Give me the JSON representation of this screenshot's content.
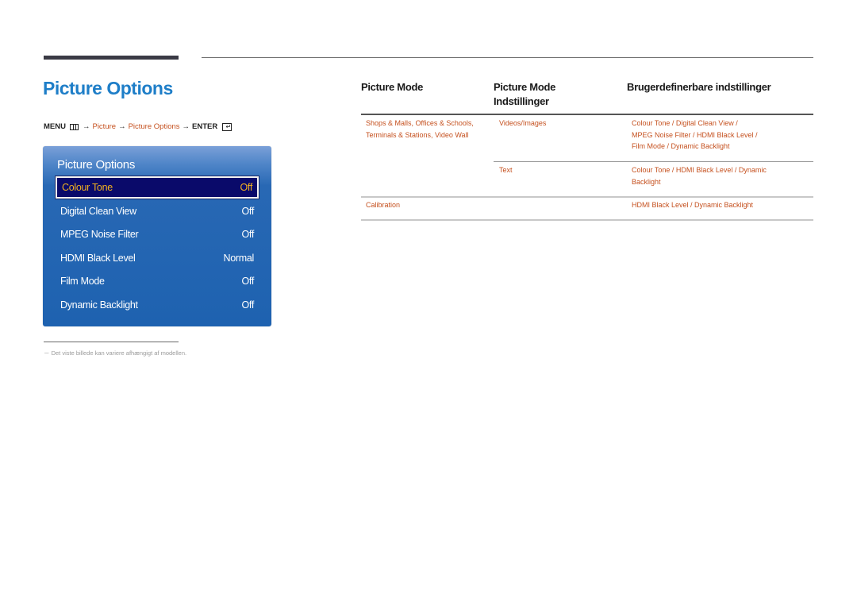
{
  "page": {
    "title": "Picture Options",
    "menu_path": {
      "menu_label": "MENU",
      "arrow": "→",
      "link_1": "Picture",
      "link_2": "Picture Options",
      "enter_label": "ENTER",
      "enter_glyph": "↵"
    },
    "footnote": "－ Det viste billede kan variere afhængigt af modellen."
  },
  "osd": {
    "title": "Picture Options",
    "items": [
      {
        "label": "Colour Tone",
        "value": "Off",
        "selected": true
      },
      {
        "label": "Digital Clean View",
        "value": "Off"
      },
      {
        "label": "MPEG Noise Filter",
        "value": "Off"
      },
      {
        "label": "HDMI Black Level",
        "value": "Normal"
      },
      {
        "label": "Film Mode",
        "value": "Off"
      },
      {
        "label": "Dynamic Backlight",
        "value": "Off"
      }
    ],
    "colors": {
      "selected_text": "#f0b020",
      "selected_bg": "#0a0a6a",
      "panel": "#1e62b0"
    }
  },
  "table": {
    "headers": [
      "Picture Mode",
      "Picture Mode Indstillinger",
      "Brugerdefinerbare indstillinger"
    ],
    "header_2_lines": [
      "Picture Mode",
      "Indstillinger"
    ],
    "rows": [
      {
        "mode_lines": [
          "Shops & Malls, Offices & Schools,",
          "Terminals & Stations, Video Wall"
        ],
        "setting": "Videos/Images",
        "custom_lines": [
          "Colour Tone / Digital Clean View /",
          "MPEG Noise Filter / HDMI Black Level /",
          "Film Mode / Dynamic Backlight"
        ]
      },
      {
        "mode_lines": [],
        "setting": "Text",
        "custom_lines": [
          "Colour Tone / HDMI Black Level / Dynamic",
          "Backlight"
        ]
      },
      {
        "mode_lines": [
          "Calibration"
        ],
        "setting": "",
        "custom_lines": [
          "HDMI Black Level / Dynamic Backlight"
        ]
      }
    ],
    "link_color": "#c5501e"
  }
}
